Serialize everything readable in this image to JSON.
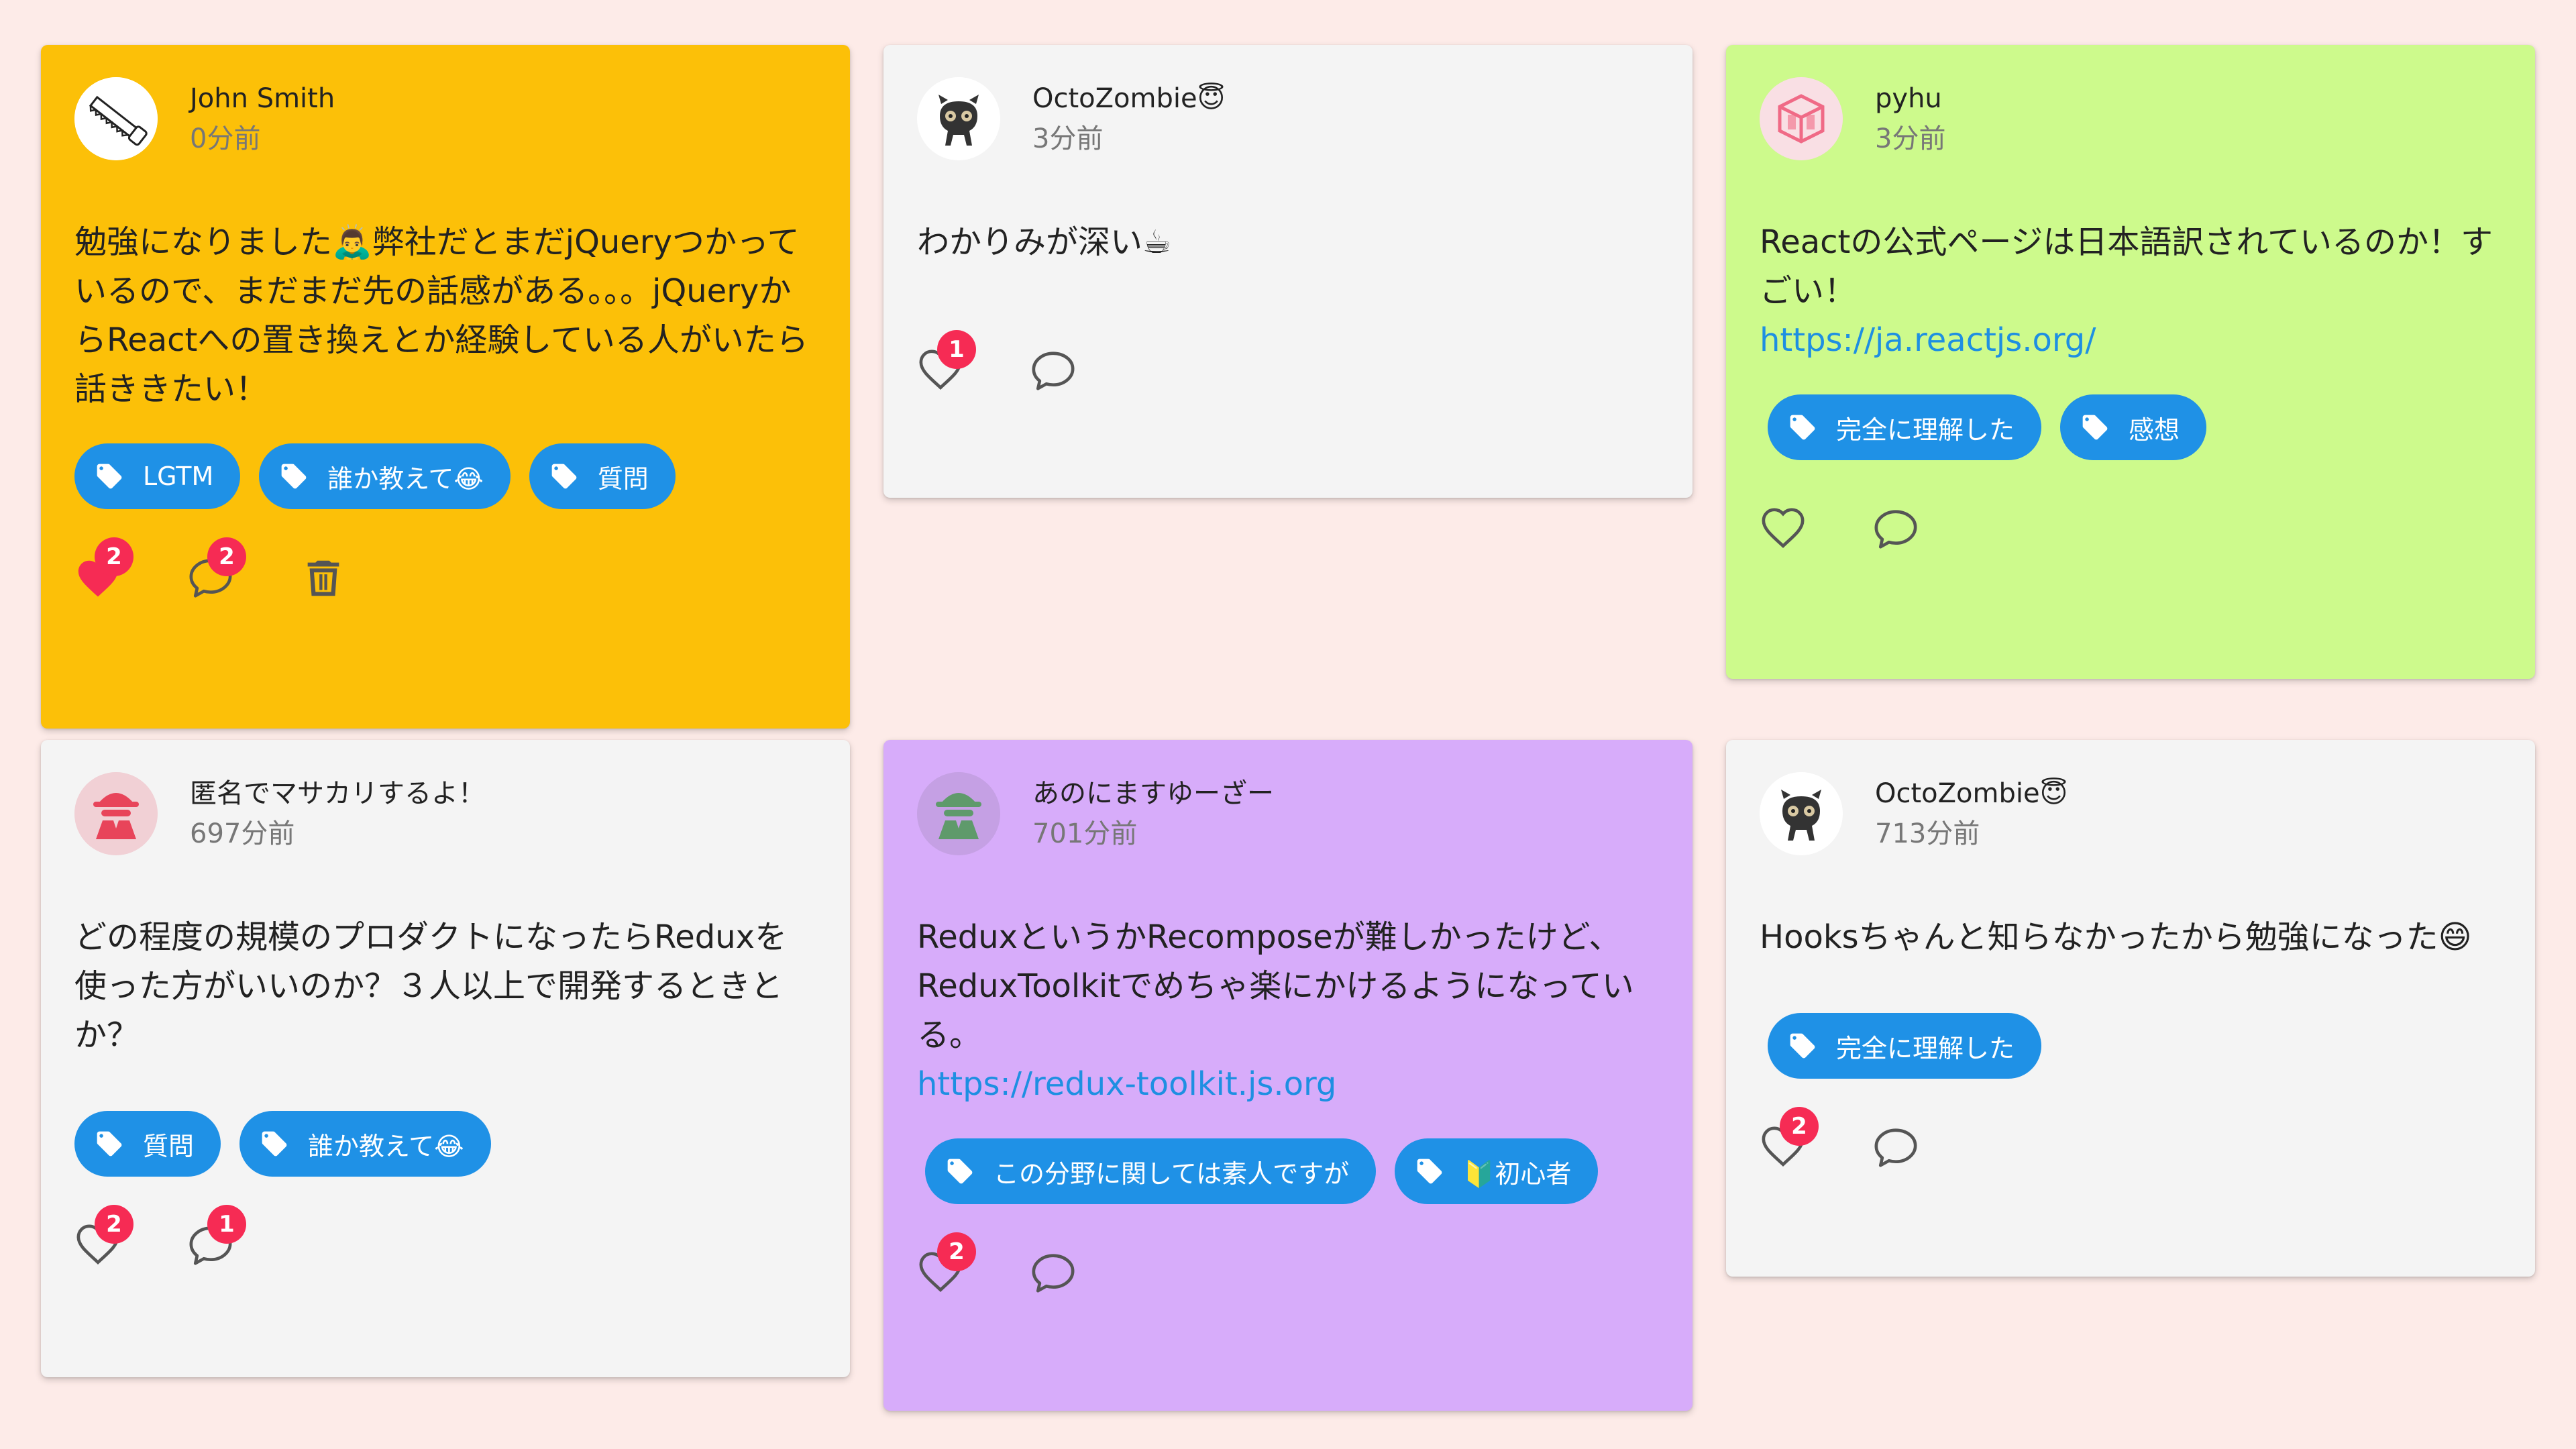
{
  "posts": [
    {
      "author": "John Smith",
      "time": "0分前",
      "text": "勉強になりました🙇‍♂️弊社だとまだjQueryつかっているので、まだまだ先の話感がある。。。jQueryからReactへの置き換えとか経験している人がいたら話ききたい！",
      "tags": [
        "LGTM",
        "誰か教えて😂",
        "質問"
      ],
      "likes": "2",
      "comments": "2",
      "color": "#fcc008"
    },
    {
      "author": "OctoZombie😇",
      "time": "3分前",
      "text": "わかりみが深い☕",
      "likes": "1",
      "color": "#f4f4f4"
    },
    {
      "author": "pyhu",
      "time": "3分前",
      "text": "Reactの公式ページは日本語訳されているのか！すごい！",
      "link": "https://ja.reactjs.org/",
      "tags": [
        "完全に理解した",
        "感想"
      ],
      "color": "#cdfa8c"
    },
    {
      "author": "匿名でマサカリするよ！",
      "time": "697分前",
      "text": "どの程度の規模のプロダクトになったらReduxを使った方がいいのか？３人以上で開発するときとか？",
      "tags": [
        "質問",
        "誰か教えて😂"
      ],
      "likes": "2",
      "comments": "1",
      "color": "#f4f4f4"
    },
    {
      "author": "あのにますゆーざー",
      "time": "701分前",
      "text": "ReduxというかRecomposeが難しかったけど、ReduxToolkitでめちゃ楽にかけるようになっている。",
      "link": "https://redux-toolkit.js.org",
      "tags": [
        "この分野に関しては素人ですが",
        "🔰初心者"
      ],
      "likes": "2",
      "color": "#d7acfa"
    },
    {
      "author": "OctoZombie😇",
      "time": "713分前",
      "text": "Hooksちゃんと知らなかったから勉強になった😄",
      "tags": [
        "完全に理解した"
      ],
      "likes": "2",
      "color": "#f4f4f4"
    }
  ],
  "icons": {
    "tag": "tag-icon",
    "like": "heart-icon",
    "comment": "comment-icon",
    "delete": "trash-icon"
  }
}
